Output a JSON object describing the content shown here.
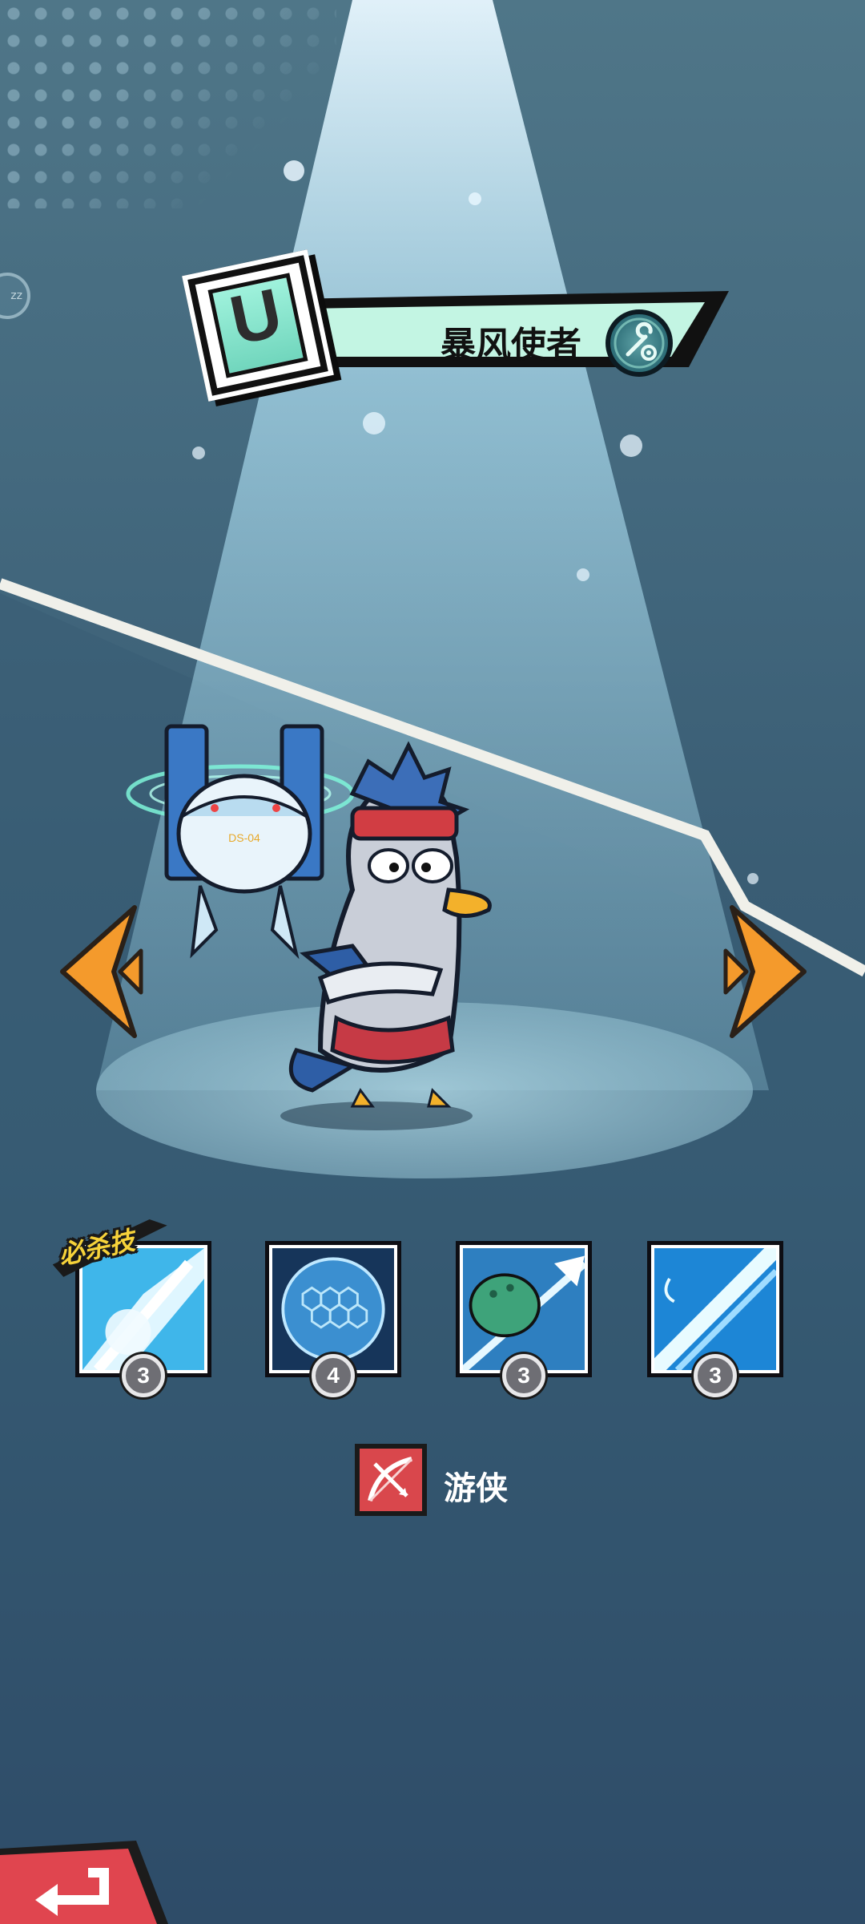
{
  "hero": {
    "rank": "U",
    "name": "暴风使者",
    "class_label": "游侠",
    "class_icon": "bow-class-icon",
    "type_icon": "wrench-gear-icon"
  },
  "skills": [
    {
      "name": "ultimate-skill",
      "level": "3",
      "tag": "必杀技"
    },
    {
      "name": "energy-sphere-skill",
      "level": "4"
    },
    {
      "name": "piercing-arrow-skill",
      "level": "3"
    },
    {
      "name": "wind-slash-skill",
      "level": "3"
    }
  ],
  "colors": {
    "accent_orange": "#f49a2c",
    "banner_mint": "#bff4e2",
    "back_red": "#e0454f",
    "class_red": "#d9474c"
  }
}
